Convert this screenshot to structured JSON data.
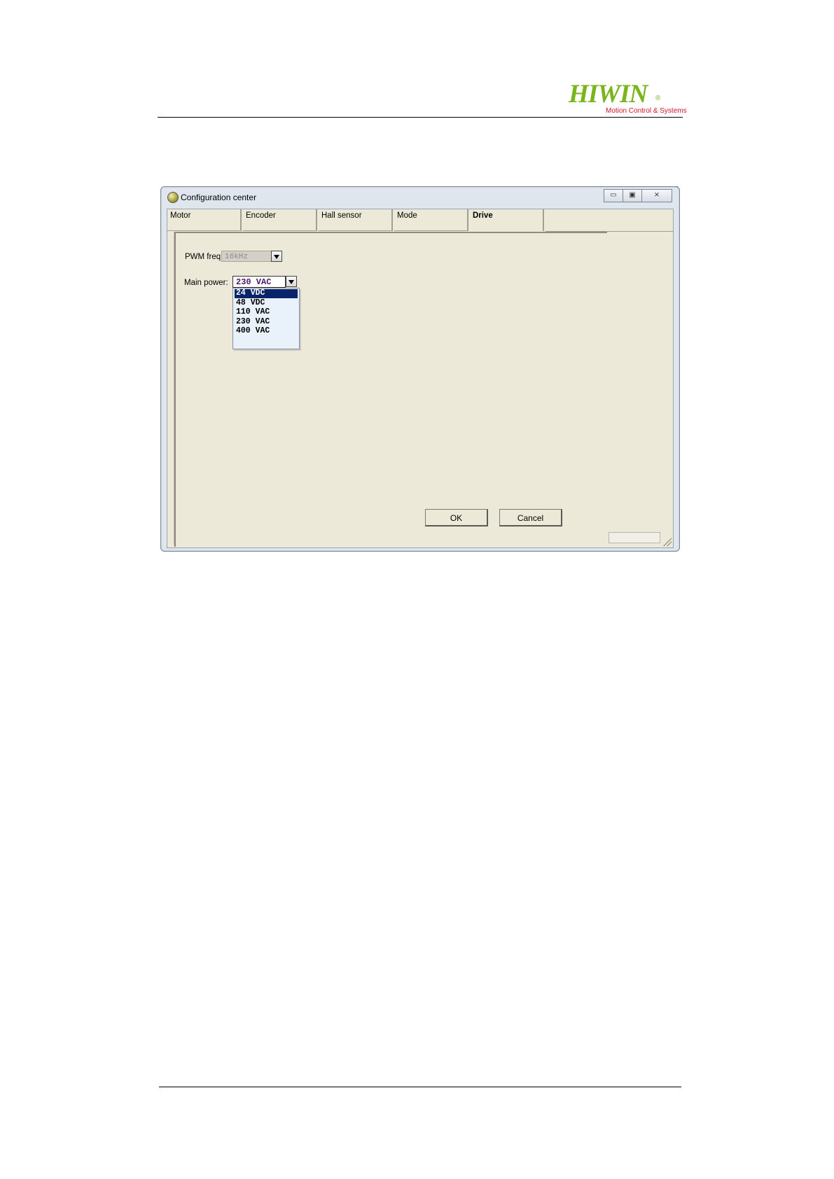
{
  "brand": {
    "name": "HIWIN",
    "registered": "®",
    "tagline": "Motion Control & Systems",
    "primary_color": "#7ab51d",
    "tagline_color": "#d2142a"
  },
  "window": {
    "title": "Configuration center",
    "icon": "app-gear-icon",
    "controls": {
      "minimize": "▭",
      "maximize": "▣",
      "close": "⨯"
    }
  },
  "tabs": [
    {
      "label": "Motor",
      "active": false
    },
    {
      "label": "Encoder",
      "active": false
    },
    {
      "label": "Hall sensor",
      "active": false
    },
    {
      "label": "Mode",
      "active": false
    },
    {
      "label": "Drive",
      "active": true
    }
  ],
  "drive": {
    "pwm_label": "PWM freq.:",
    "pwm_value": "16kHz",
    "main_power_label": "Main power:",
    "main_power_value": "230 VAC",
    "main_power_options": [
      "24 VDC",
      "48 VDC",
      "110 VAC",
      "230 VAC",
      "400 VAC"
    ],
    "highlighted_option": "24 VDC"
  },
  "buttons": {
    "ok": "OK",
    "cancel": "Cancel"
  }
}
